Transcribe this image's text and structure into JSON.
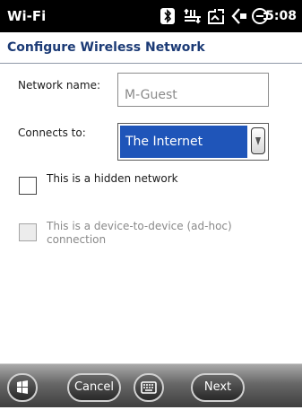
{
  "status_bar": {
    "app_name": "Wi-Fi",
    "clock": "5:08",
    "icons": [
      "bluetooth-icon",
      "data-transfer-icon",
      "signal-icon",
      "volume-icon",
      "battery-charging-icon"
    ]
  },
  "header": {
    "title": "Configure Wireless Network"
  },
  "form": {
    "network_name_label": "Network name:",
    "network_name_value": "M-Guest",
    "connects_to_label": "Connects to:",
    "connects_to_value": "The Internet",
    "hidden_network_label": "This is a hidden network",
    "hidden_network_checked": false,
    "adhoc_label_line1": "This is a device-to-device (ad-hoc)",
    "adhoc_label_line2": "connection",
    "adhoc_checked": false,
    "adhoc_enabled": false
  },
  "bottom_bar": {
    "cancel_label": "Cancel",
    "next_label": "Next",
    "icons": [
      "windows-start-icon",
      "keyboard-icon"
    ]
  },
  "colors": {
    "title_text": "#1c3b76",
    "selected_value_bg": "#1f55b9",
    "disabled_text": "#8a8a8a"
  }
}
